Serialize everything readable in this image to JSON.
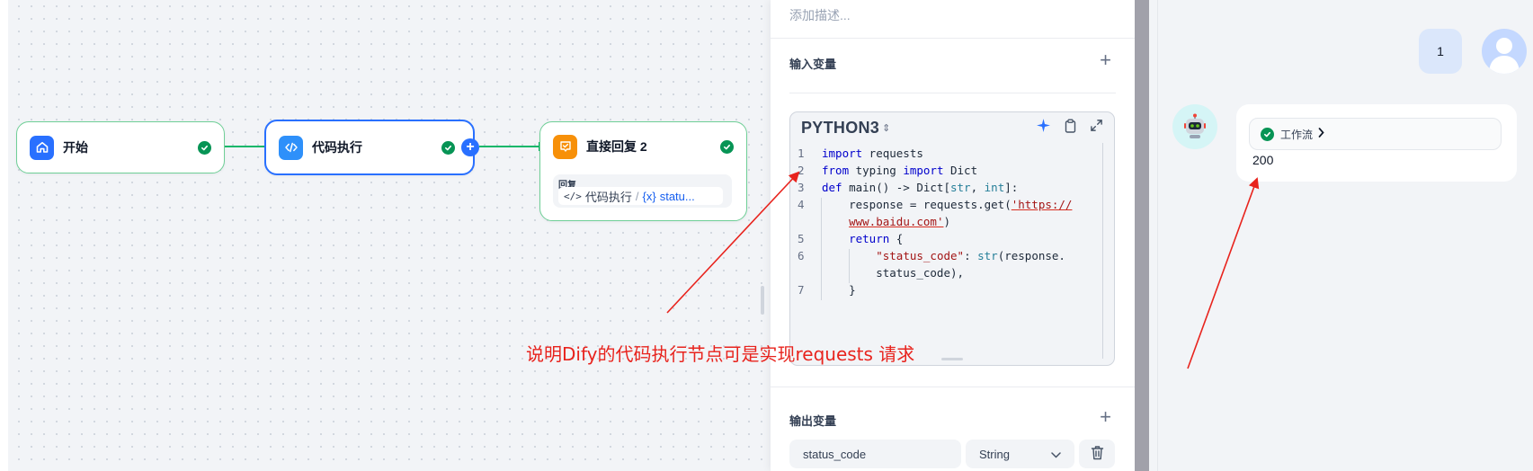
{
  "canvas": {
    "nodes": {
      "start": {
        "title": "开始"
      },
      "code": {
        "title": "代码执行"
      },
      "reply": {
        "title": "直接回复 2",
        "label": "回复",
        "chip_node": "代码执行",
        "chip_var": "statu..."
      }
    }
  },
  "panel": {
    "description_placeholder": "添加描述...",
    "input_vars_title": "输入变量",
    "editor": {
      "language": "PYTHON3",
      "line_numbers": [
        "1",
        "2",
        "3",
        "4",
        "5",
        "6",
        "7"
      ]
    },
    "output_vars_title": "输出变量",
    "output_var": {
      "name": "status_code",
      "type": "String"
    }
  },
  "chat": {
    "user_message": "1",
    "workflow_label": "工作流",
    "answer": "200"
  },
  "annotation": {
    "text": "说明Dify的代码执行节点可是实现requests 请求",
    "color": "#e8231d"
  },
  "colors": {
    "accent": "#2970ff",
    "success": "#079455",
    "start_icon": "#2970ff",
    "code_icon": "#2e90fa",
    "reply_icon": "#f79009"
  },
  "icons": [
    "home-icon",
    "code-icon",
    "reply-icon",
    "check-icon",
    "plus-icon",
    "sparkle-icon",
    "clipboard-icon",
    "expand-icon",
    "chevron-down-icon",
    "trash-icon",
    "robot-icon",
    "chevron-right-icon"
  ]
}
